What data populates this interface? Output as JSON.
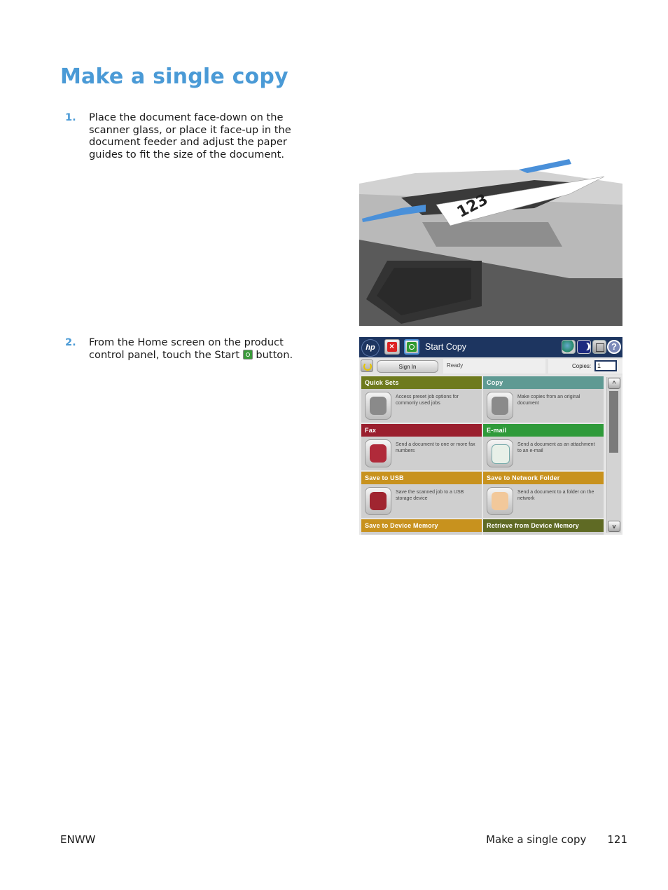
{
  "page": {
    "title": "Make a single copy",
    "steps": [
      {
        "number": "1.",
        "text": "Place the document face-down on the scanner glass, or place it face-up in the document feeder and adjust the paper guides to fit the size of the document."
      },
      {
        "number": "2.",
        "text_before": "From the Home screen on the product control panel, touch the Start",
        "text_after": "button."
      }
    ],
    "illustration": {
      "description": "Document feeder with paper guides",
      "paper_label": "123",
      "arrow_color": "#4a90d9"
    }
  },
  "control_panel": {
    "logo": "hp",
    "start_copy_label": "Start Copy",
    "icons": [
      "hp-logo-icon",
      "stop-icon",
      "start-icon",
      "globe-icon",
      "sleep-icon",
      "network-icon",
      "help-icon"
    ],
    "help_glyph": "?",
    "sign_in_label": "Sign In",
    "status": "Ready",
    "copies_label": "Copies:",
    "copies_value": "1",
    "scroll_up_glyph": "^",
    "scroll_down_glyph": "v",
    "tiles": [
      {
        "title": "Quick Sets",
        "desc": "Access preset job options for commonly used jobs",
        "color": "#6e7a1e",
        "icon": "clipboard-icon"
      },
      {
        "title": "Copy",
        "desc": "Make copies from an original document",
        "color": "#5f9a93",
        "icon": "copy-icon"
      },
      {
        "title": "Fax",
        "desc": "Send a document to one or more fax numbers",
        "color": "#9a1f2e",
        "icon": "fax-icon"
      },
      {
        "title": "E-mail",
        "desc": "Send a document as an attachment to an e-mail",
        "color": "#2f9a3a",
        "icon": "envelope-icon"
      },
      {
        "title": "Save to USB",
        "desc": "Save the scanned job to a USB storage device",
        "color": "#c8921e",
        "icon": "usb-icon"
      },
      {
        "title": "Save to Network Folder",
        "desc": "Send a document to a folder on the network",
        "color": "#c8921e",
        "icon": "folder-icon"
      },
      {
        "title": "Save to Device Memory",
        "desc": "",
        "color": "#c8921e",
        "icon": ""
      },
      {
        "title": "Retrieve from Device Memory",
        "desc": "",
        "color": "#5f6a24",
        "icon": ""
      }
    ]
  },
  "footer": {
    "left": "ENWW",
    "section": "Make a single copy",
    "page_number": "121"
  }
}
